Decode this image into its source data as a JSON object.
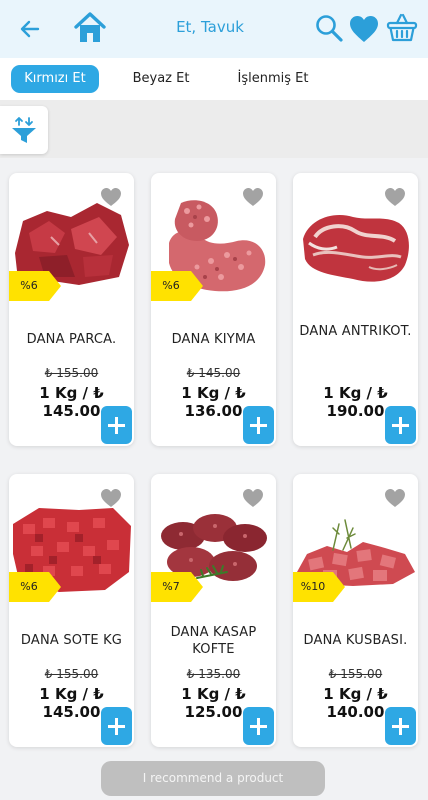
{
  "header": {
    "title": "Et, Tavuk",
    "back_icon": "arrow-left-icon",
    "home_icon": "home-icon",
    "search_icon": "search-icon",
    "favorites_icon": "heart-icon",
    "basket_icon": "basket-icon",
    "accent_color": "#2c9fd9"
  },
  "tabs": [
    {
      "label": "Kırmızı Et",
      "active": true
    },
    {
      "label": "Beyaz Et",
      "active": false
    },
    {
      "label": "İşlenmiş Et",
      "active": false
    }
  ],
  "filter": {
    "icon": "sort-filter-icon"
  },
  "products": [
    {
      "name": "DANA PARCA.",
      "discount": "%6",
      "old_price": "₺ 155.00",
      "price": "1 Kg / ₺ 145.00"
    },
    {
      "name": "DANA KIYMA",
      "discount": "%6",
      "old_price": "₺ 145.00",
      "price": "1 Kg / ₺ 136.00"
    },
    {
      "name": "DANA ANTRIKOT.",
      "discount": "",
      "old_price": "",
      "price": "1 Kg / ₺ 190.00"
    },
    {
      "name": "DANA SOTE KG",
      "discount": "%6",
      "old_price": "₺ 155.00",
      "price": "1 Kg / ₺ 145.00"
    },
    {
      "name": "DANA KASAP KOFTE",
      "discount": "%7",
      "old_price": "₺ 135.00",
      "price": "1 Kg / ₺ 125.00"
    },
    {
      "name": "DANA KUSBASI.",
      "discount": "%10",
      "old_price": "₺ 155.00",
      "price": "1 Kg / ₺ 140.00"
    }
  ],
  "recommend_label": "I recommend a product"
}
